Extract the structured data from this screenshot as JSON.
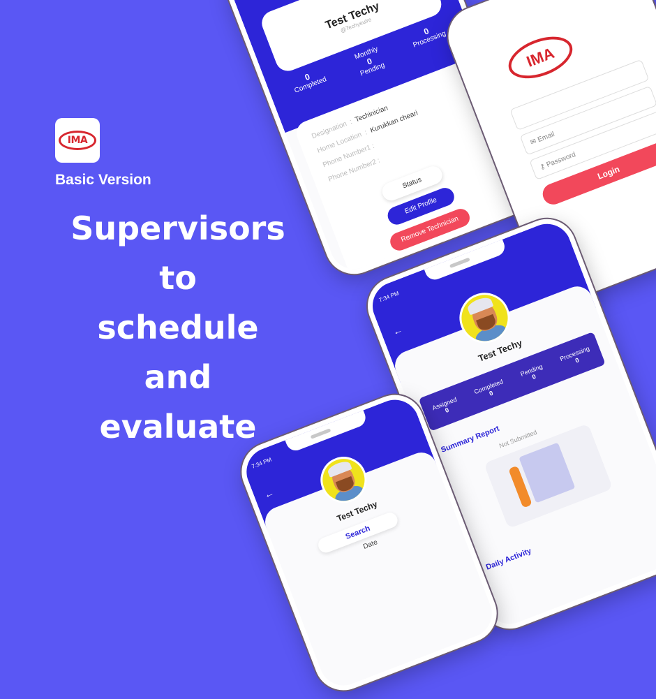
{
  "logo": {
    "text": "IMA"
  },
  "version_label": "Basic Version",
  "headline": [
    "Supervisors",
    "to",
    "schedule",
    "and",
    "evaluate"
  ],
  "profile_screen": {
    "name": "Test Techy",
    "username": "@Techyeuire",
    "stats": [
      {
        "label": "Completed",
        "value": "0"
      },
      {
        "label": "Monthly",
        "value": ""
      },
      {
        "label": "Pending",
        "value": "0"
      },
      {
        "label": "Processing",
        "value": "0"
      }
    ],
    "fields": [
      {
        "label": "Designation",
        "value": "Techinician"
      },
      {
        "label": "Home Location",
        "value": "Kurukkan cheari"
      },
      {
        "label": "Phone Number1",
        "value": ""
      },
      {
        "label": "Phone Number2",
        "value": ""
      }
    ],
    "status_label": "Status",
    "edit_button": "Edit Profile",
    "remove_button": "Remove Technician"
  },
  "login_screen": {
    "email_placeholder": "Email",
    "password_placeholder": "Password",
    "login_button": "Login"
  },
  "dashboard_screen": {
    "time": "7:34 PM",
    "name": "Test Techy",
    "stats": [
      {
        "label": "Assigned",
        "value": "0"
      },
      {
        "label": "Completed",
        "value": "0"
      },
      {
        "label": "Pending",
        "value": "0"
      },
      {
        "label": "Processing",
        "value": "0"
      }
    ],
    "summary_title": "Summary Report",
    "summary_status": "Not Submitted",
    "daily_title": "Daily Activity"
  },
  "search_screen": {
    "time": "7:34 PM",
    "name": "Test Techy",
    "search_label": "Search",
    "date_label": "Date"
  },
  "colors": {
    "background": "#5a57f4",
    "primary": "#2d25d8",
    "accent_red": "#f2485b",
    "logo_red": "#d7262e"
  }
}
